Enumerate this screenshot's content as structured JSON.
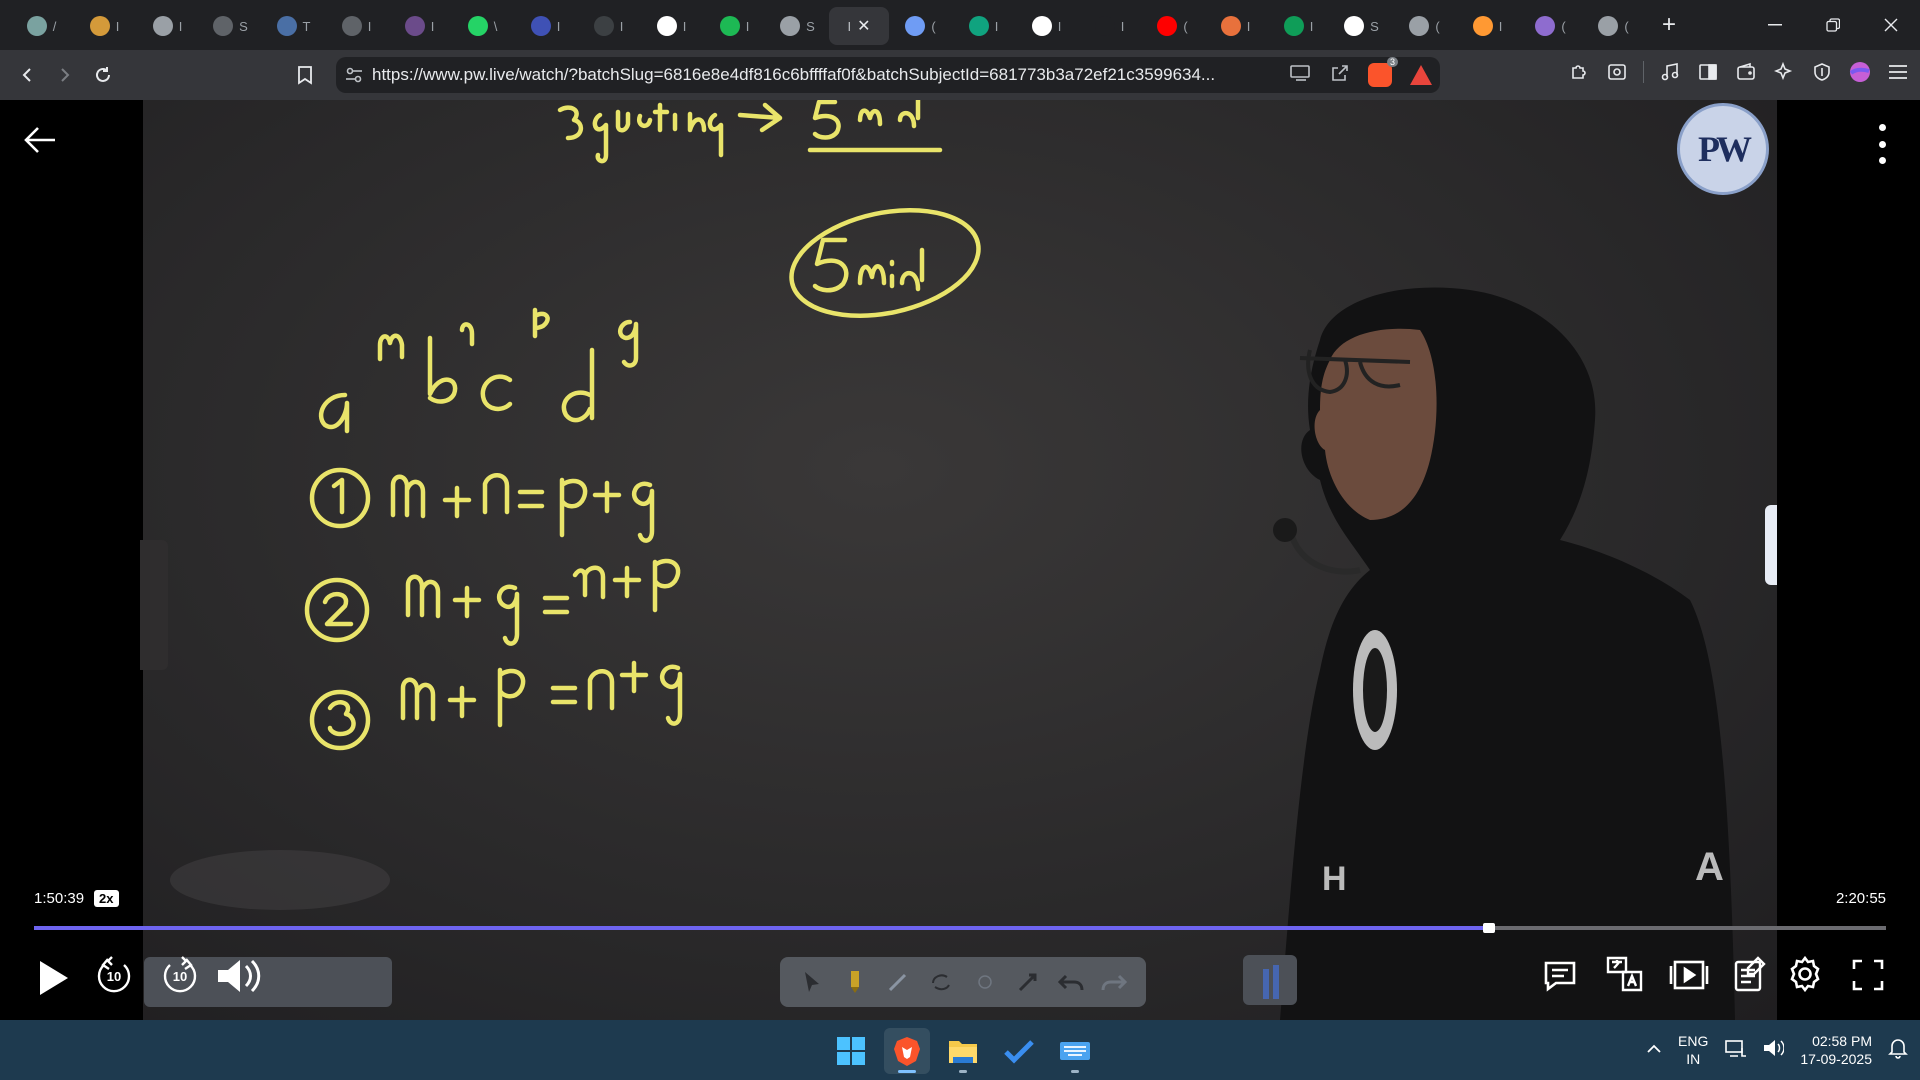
{
  "browser": {
    "tabs": [
      {
        "icon": "chatgpt-icon",
        "cut": "/",
        "color": "#7aa2a0"
      },
      {
        "icon": "clock-icon",
        "cut": "I",
        "color": "#d49a3a"
      },
      {
        "icon": "globe-icon",
        "cut": "I",
        "color": "#9aa0a6"
      },
      {
        "icon": "dark-circle-icon",
        "cut": "S",
        "color": "#5f6368"
      },
      {
        "icon": "w-logo-icon",
        "cut": "T",
        "color": "#4a6fa5"
      },
      {
        "icon": "grey-circle-icon",
        "cut": "I",
        "color": "#5f6368"
      },
      {
        "icon": "purple-circle-icon",
        "cut": "I",
        "color": "#6b4b8a"
      },
      {
        "icon": "whatsapp-icon",
        "cut": "\\",
        "color": "#25d366"
      },
      {
        "icon": "bookmark-blue-icon",
        "cut": "I",
        "color": "#3f51b5"
      },
      {
        "icon": "text-logo-icon",
        "cut": "I",
        "color": "#3c4043"
      },
      {
        "icon": "google-icon",
        "cut": "I",
        "color": "#ffffff"
      },
      {
        "icon": "spotify-icon",
        "cut": "I",
        "color": "#1db954"
      },
      {
        "icon": "globe-icon",
        "cut": "S",
        "color": "#9aa0a6"
      }
    ],
    "active_tab_cut": "I",
    "tabs_after": [
      {
        "icon": "gemini-icon",
        "cut": "(",
        "color": "#6f9cf4"
      },
      {
        "icon": "chat-icon",
        "cut": "I",
        "color": "#10a37f"
      },
      {
        "icon": "google-icon",
        "cut": "I",
        "color": "#ffffff"
      },
      {
        "icon": "square-icon",
        "cut": "I",
        "color": "#202124"
      },
      {
        "icon": "youtube-icon",
        "cut": "(",
        "color": "#ff0000"
      },
      {
        "icon": "pill-icon",
        "cut": "I",
        "color": "#e8713c"
      },
      {
        "icon": "chart-green-icon",
        "cut": "I",
        "color": "#0f9d58"
      },
      {
        "icon": "wikipedia-icon",
        "cut": "S",
        "color": "#ffffff"
      },
      {
        "icon": "globe-icon",
        "cut": "(",
        "color": "#9aa0a6"
      },
      {
        "icon": "india-flag-icon",
        "cut": "I",
        "color": "#ff9933"
      },
      {
        "icon": "purple-ring-icon",
        "cut": "(",
        "color": "#8e6ccf"
      },
      {
        "icon": "globe-icon",
        "cut": "(",
        "color": "#9aa0a6"
      }
    ],
    "url": "https://www.pw.live/watch/?batchSlug=6816e8e4df816c6bffffaf0f&batchSubjectId=681773b3a72ef21c3599634...",
    "shield_badge": "3"
  },
  "player": {
    "current_time": "1:50:39",
    "speed": "2x",
    "duration": "2:20:55",
    "progress": 0.7854,
    "skip_back": "10",
    "skip_forward": "10",
    "logo_text": "PW",
    "board": {
      "top_note": "3 questions → 5 min",
      "circled": "5 min",
      "expression": "a^m b^n c^p d^q",
      "items": [
        {
          "num": "1",
          "eq": "m+n = p+q"
        },
        {
          "num": "2",
          "eq": "m+q = n+p"
        },
        {
          "num": "3",
          "eq": "m+p = n+q"
        }
      ]
    }
  },
  "taskbar": {
    "lang_top": "ENG",
    "lang_bottom": "IN",
    "time": "02:58 PM",
    "date": "17-09-2025"
  }
}
